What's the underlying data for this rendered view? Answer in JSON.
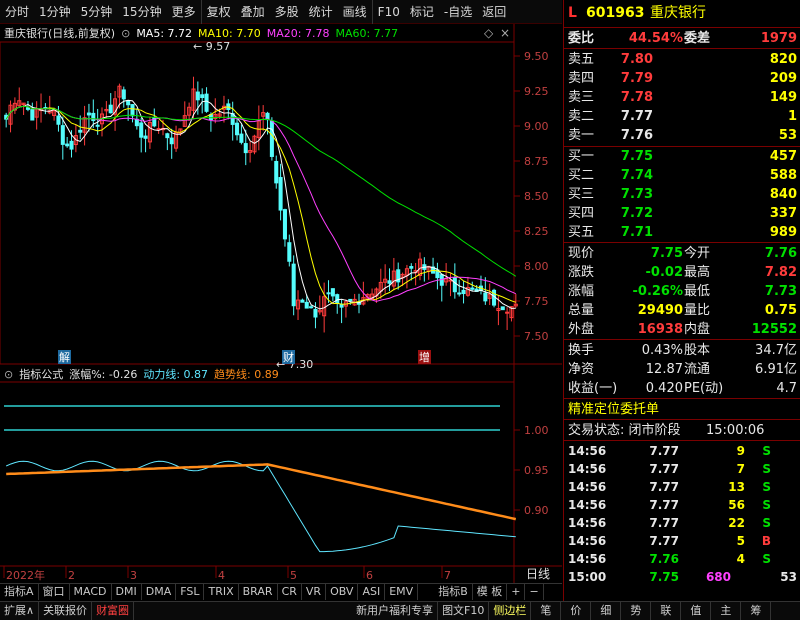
{
  "toolbar": {
    "items": [
      "分时",
      "1分钟",
      "5分钟",
      "15分钟",
      "更多",
      "复权",
      "叠加",
      "多股",
      "统计",
      "画线",
      "F10",
      "标记",
      "-自选",
      "返回"
    ]
  },
  "chart_header": {
    "title": "重庆银行(日线,前复权)",
    "ma5_label": "MA5: 7.72",
    "ma10_label": "MA10: 7.70",
    "ma20_label": "MA20: 7.78",
    "ma60_label": "MA60: 7.77",
    "colors": {
      "ma5": "#ffffff",
      "ma10": "#ffff00",
      "ma20": "#ff40ff",
      "ma60": "#00e000"
    }
  },
  "indicator_header": {
    "name": "指标公式",
    "zhangfu": "涨幅%: -0.26",
    "dongli": "动力线: 0.87",
    "qushi": "趋势线: 0.89"
  },
  "annotations": {
    "high": "9.57",
    "low": "7.30",
    "mark1": "解",
    "mark2": "财",
    "mark3": "增"
  },
  "chart_data": [
    {
      "type": "candlestick",
      "title": "重庆银行(日线,前复权)",
      "y_ticks": [
        "9.50",
        "9.25",
        "9.00",
        "8.75",
        "8.50",
        "8.25",
        "8.00",
        "7.75",
        "7.50"
      ],
      "ylim": [
        7.3,
        9.6
      ],
      "x_ticks": [
        "2022年",
        "2",
        "3",
        "4",
        "5",
        "6",
        "7"
      ],
      "high": 9.57,
      "low": 7.3
    },
    {
      "type": "line",
      "title": "指标公式",
      "y_ticks": [
        "1.00",
        "0.95",
        "0.90"
      ],
      "ylim": [
        0.83,
        1.06
      ],
      "series": [
        {
          "name": "动力线",
          "last": 0.87
        },
        {
          "name": "趋势线",
          "last": 0.89
        }
      ]
    }
  ],
  "x_axis_right_label": "日线",
  "bottom_tabs": [
    "指标A",
    "窗口",
    "MACD",
    "DMI",
    "DMA",
    "FSL",
    "TRIX",
    "BRAR",
    "CR",
    "VR",
    "OBV",
    "ASI",
    "EMV",
    "指标B",
    "模 板",
    "+",
    "−"
  ],
  "status_bar": [
    "扩展∧",
    "关联报价",
    "财富圈",
    "新用户福利专享",
    "图文F10",
    "侧边栏",
    "笔",
    "价",
    "细",
    "势",
    "联",
    "值",
    "主",
    "筹"
  ],
  "quote": {
    "code": "601963",
    "name": "重庆银行",
    "weibi_label": "委比",
    "weibi": "44.54%",
    "weicha_label": "委差",
    "weicha": "1979",
    "asks": [
      {
        "label": "卖五",
        "price": "7.80",
        "vol": "820"
      },
      {
        "label": "卖四",
        "price": "7.79",
        "vol": "209"
      },
      {
        "label": "卖三",
        "price": "7.78",
        "vol": "149"
      },
      {
        "label": "卖二",
        "price": "7.77",
        "vol": "1"
      },
      {
        "label": "卖一",
        "price": "7.76",
        "vol": "53"
      }
    ],
    "bids": [
      {
        "label": "买一",
        "price": "7.75",
        "vol": "457"
      },
      {
        "label": "买二",
        "price": "7.74",
        "vol": "588"
      },
      {
        "label": "买三",
        "price": "7.73",
        "vol": "840"
      },
      {
        "label": "买四",
        "price": "7.72",
        "vol": "337"
      },
      {
        "label": "买五",
        "price": "7.71",
        "vol": "989"
      }
    ],
    "stats": [
      {
        "l1": "现价",
        "v1": "7.75",
        "l2": "今开",
        "v2": "7.76"
      },
      {
        "l1": "涨跌",
        "v1": "-0.02",
        "l2": "最高",
        "v2": "7.82"
      },
      {
        "l1": "涨幅",
        "v1": "-0.26%",
        "l2": "最低",
        "v2": "7.73"
      },
      {
        "l1": "总量",
        "v1": "29490",
        "l2": "量比",
        "v2": "0.75"
      },
      {
        "l1": "外盘",
        "v1": "16938",
        "l2": "内盘",
        "v2": "12552"
      }
    ],
    "stats2": [
      {
        "l1": "换手",
        "v1": "0.43%",
        "l2": "股本",
        "v2": "34.7亿"
      },
      {
        "l1": "净资",
        "v1": "12.87",
        "l2": "流通",
        "v2": "6.91亿"
      },
      {
        "l1": "收益(一)",
        "v1": "0.420",
        "l2": "PE(动)",
        "v2": "4.7"
      }
    ],
    "precise_label": "精准定位委托单",
    "trade_status_label": "交易状态: 闭市阶段",
    "trade_status_time": "15:00:06",
    "ticks": [
      {
        "time": "14:56",
        "price": "7.77",
        "vol": "9",
        "side": "S"
      },
      {
        "time": "14:56",
        "price": "7.77",
        "vol": "7",
        "side": "S"
      },
      {
        "time": "14:56",
        "price": "7.77",
        "vol": "13",
        "side": "S"
      },
      {
        "time": "14:56",
        "price": "7.77",
        "vol": "56",
        "side": "S"
      },
      {
        "time": "14:56",
        "price": "7.77",
        "vol": "22",
        "side": "S"
      },
      {
        "time": "14:56",
        "price": "7.77",
        "vol": "5",
        "side": "B"
      },
      {
        "time": "14:56",
        "price": "7.76",
        "vol": "4",
        "side": "S"
      },
      {
        "time": "15:00",
        "price": "7.75",
        "vol": "680",
        "side": "53"
      }
    ]
  }
}
